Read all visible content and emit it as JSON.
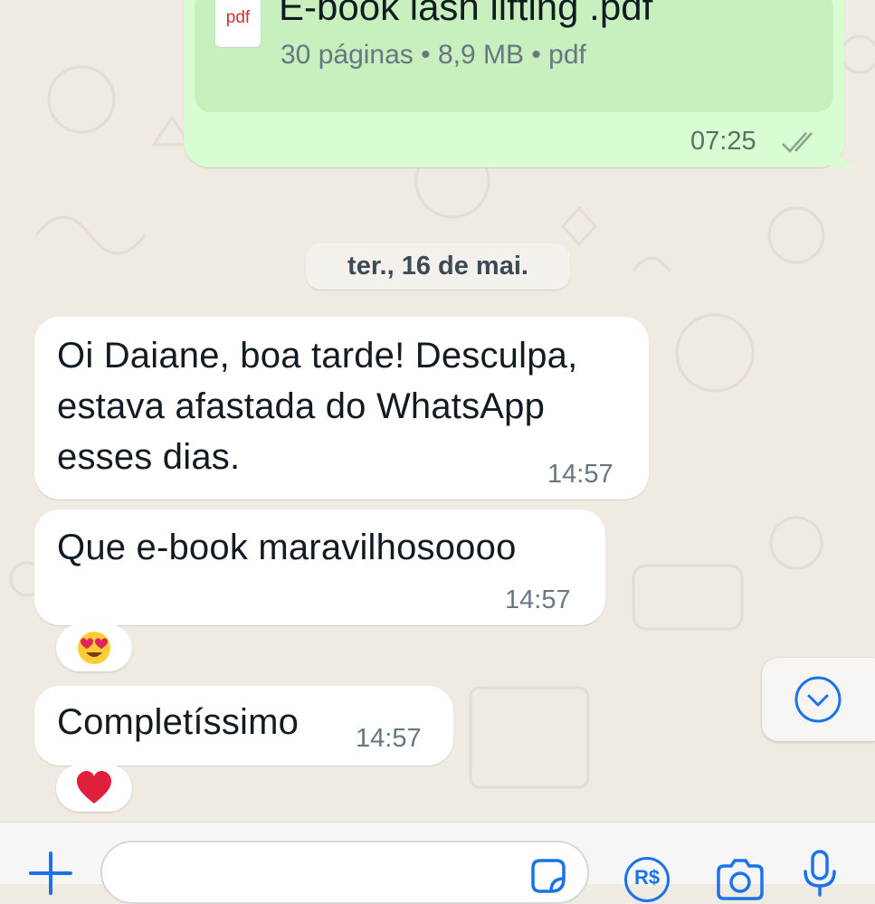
{
  "chat": {
    "file_message": {
      "icon_label": "pdf",
      "file_name": "E-book lash lifting .pdf",
      "file_meta": "30 páginas • 8,9 MB • pdf",
      "time": "07:25",
      "status_icon": "double-check-icon"
    },
    "date_separator": "ter., 16 de mai.",
    "messages": [
      {
        "lines": [
          "Oi Daiane, boa tarde! Desculpa,",
          "estava afastada do WhatsApp",
          "esses dias."
        ],
        "time": "14:57"
      },
      {
        "lines": [
          "Que e-book maravilhosoooo"
        ],
        "time": "14:57",
        "reaction": "😍"
      },
      {
        "lines": [
          "Completíssimo"
        ],
        "time": "14:57",
        "reaction": "❤️"
      }
    ]
  },
  "composer": {
    "input_placeholder": "",
    "icons": [
      "plus-icon",
      "sticker-icon",
      "payment-icon",
      "camera-icon",
      "microphone-icon"
    ],
    "payment_label": "R$"
  },
  "colors": {
    "accent": "#1a73e8",
    "incoming_bubble": "#ffffff",
    "outgoing_bubble": "#d8fdd2",
    "background": "#efeae2"
  }
}
